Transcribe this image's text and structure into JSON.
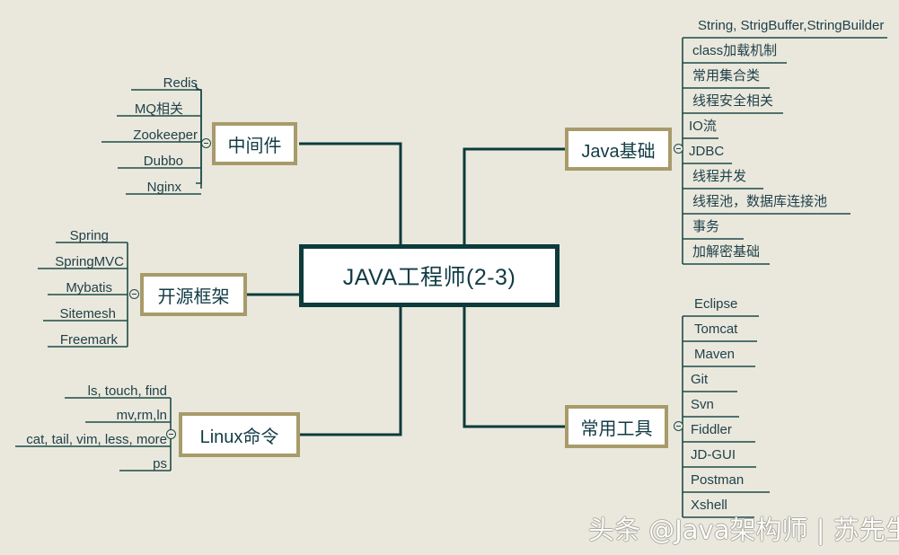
{
  "background_color": "#eae8dc",
  "root": {
    "label": "JAVA工程师(2-3)",
    "border_color": "#0c3b3b",
    "text_color": "#123b45"
  },
  "branch_style": {
    "border_color": "#a89b6a",
    "fill_color": "#ffffff",
    "line_color": "#1d4a4a"
  },
  "branches": {
    "middleware": {
      "label": "中间件",
      "side": "left",
      "toggle_icon": "collapse-minus-icon",
      "children": [
        {
          "label": "Redis"
        },
        {
          "label": "MQ相关"
        },
        {
          "label": "Zookeeper"
        },
        {
          "label": "Dubbo"
        },
        {
          "label": "Nginx"
        }
      ]
    },
    "framework": {
      "label": "开源框架",
      "side": "left",
      "toggle_icon": "collapse-minus-icon",
      "children": [
        {
          "label": "Spring"
        },
        {
          "label": "SpringMVC"
        },
        {
          "label": "Mybatis"
        },
        {
          "label": "Sitemesh"
        },
        {
          "label": "Freemark"
        }
      ]
    },
    "linux": {
      "label": "Linux命令",
      "side": "left",
      "toggle_icon": "collapse-minus-icon",
      "children": [
        {
          "label": "ls, touch, find"
        },
        {
          "label": "mv,rm,ln"
        },
        {
          "label": "cat, tail, vim, less, more"
        },
        {
          "label": "ps"
        }
      ]
    },
    "javabase": {
      "label": "Java基础",
      "side": "right",
      "toggle_icon": "collapse-minus-icon",
      "children": [
        {
          "label": "String, StrigBuffer,StringBuilder"
        },
        {
          "label": "class加载机制"
        },
        {
          "label": "常用集合类"
        },
        {
          "label": "线程安全相关"
        },
        {
          "label": "IO流"
        },
        {
          "label": "JDBC"
        },
        {
          "label": "线程并发"
        },
        {
          "label": "线程池，数据库连接池"
        },
        {
          "label": "事务"
        },
        {
          "label": "加解密基础"
        }
      ]
    },
    "tools": {
      "label": "常用工具",
      "side": "right",
      "toggle_icon": "collapse-minus-icon",
      "children": [
        {
          "label": "Eclipse"
        },
        {
          "label": "Tomcat"
        },
        {
          "label": "Maven"
        },
        {
          "label": "Git"
        },
        {
          "label": "Svn"
        },
        {
          "label": "Fiddler"
        },
        {
          "label": "JD-GUI"
        },
        {
          "label": "Postman"
        },
        {
          "label": "Xshell"
        }
      ]
    }
  },
  "watermark": {
    "text": "头条 @Java架构师 | 苏先生"
  }
}
